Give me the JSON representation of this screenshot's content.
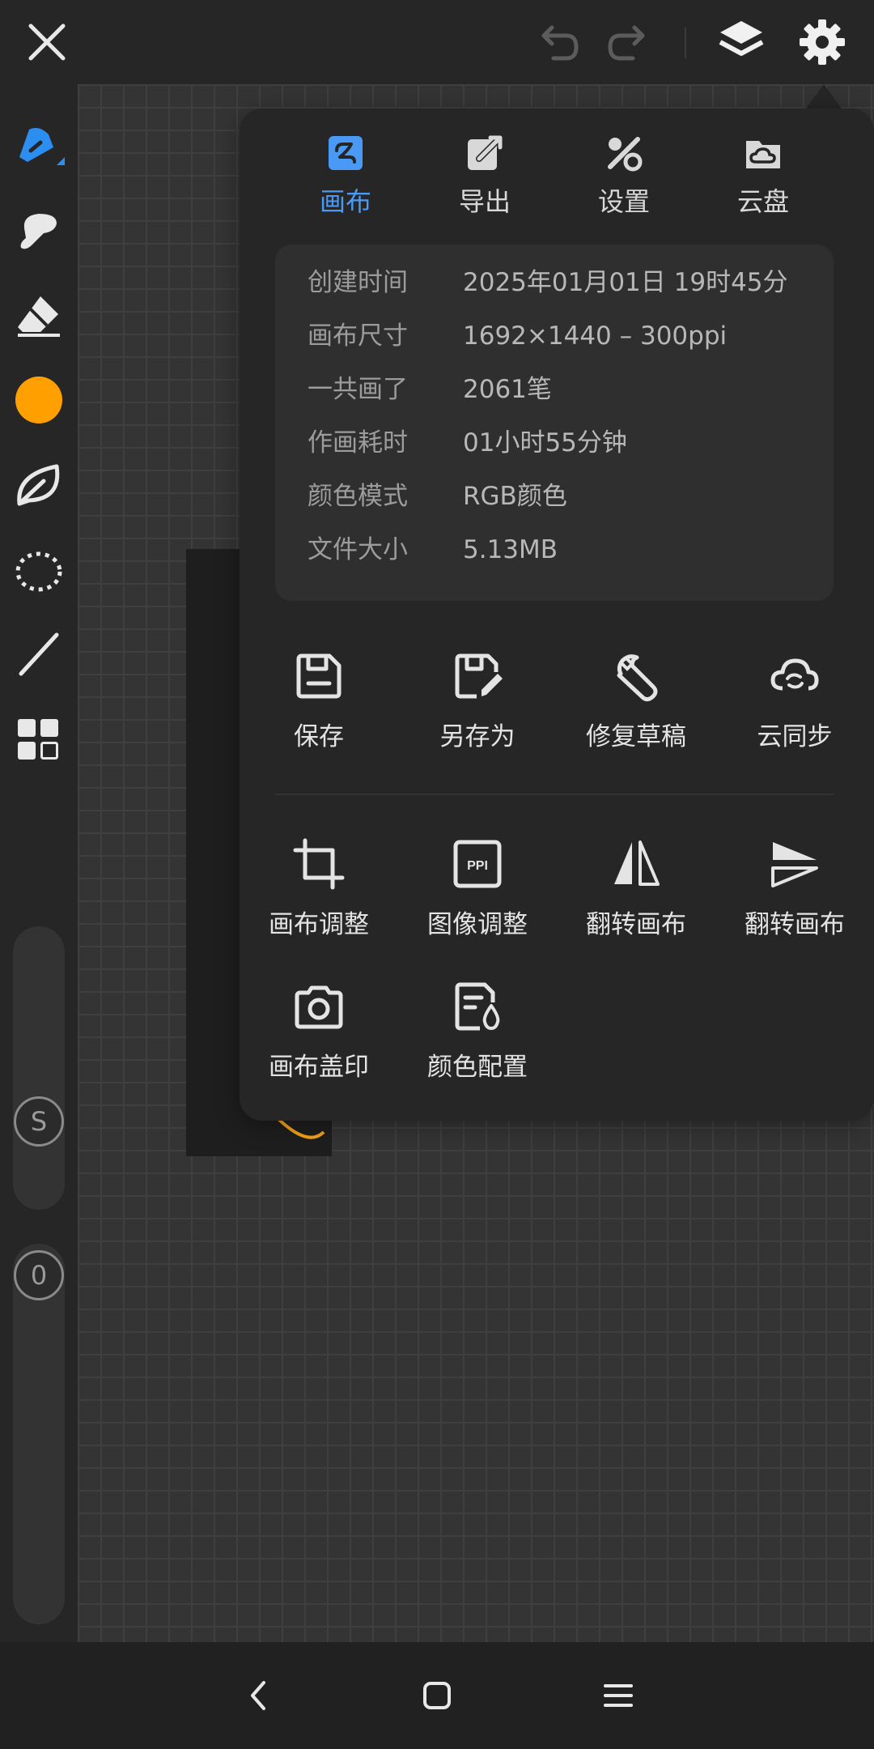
{
  "colors": {
    "accent": "#4a9af5",
    "brush_color": "#ffa000",
    "background": "#262626"
  },
  "topbar": {
    "icons": [
      "close-icon",
      "undo-icon",
      "redo-icon",
      "layers-icon",
      "settings-icon"
    ]
  },
  "left_toolbar": {
    "tools": [
      "pen-icon",
      "smudge-icon",
      "eraser-icon",
      "color-swatch",
      "leaf-icon",
      "lasso-icon",
      "line-icon",
      "grid-icon"
    ],
    "size_slider_label": "S",
    "opacity_slider_label": "0"
  },
  "panel": {
    "tabs": [
      {
        "label": "画布",
        "icon": "canvas-icon",
        "active": true
      },
      {
        "label": "导出",
        "icon": "export-icon",
        "active": false
      },
      {
        "label": "设置",
        "icon": "tools-settings-icon",
        "active": false
      },
      {
        "label": "云盘",
        "icon": "cloud-drive-icon",
        "active": false
      }
    ],
    "info": [
      {
        "label": "创建时间",
        "value": "2025年01月01日 19时45分"
      },
      {
        "label": "画布尺寸",
        "value": "1692×1440 – 300ppi"
      },
      {
        "label": "一共画了",
        "value": "2061笔"
      },
      {
        "label": "作画耗时",
        "value": "01小时55分钟"
      },
      {
        "label": "颜色模式",
        "value": "RGB颜色"
      },
      {
        "label": "文件大小",
        "value": "5.13MB"
      }
    ],
    "actions_row1": [
      {
        "label": "保存",
        "icon": "save-icon"
      },
      {
        "label": "另存为",
        "icon": "save-as-icon"
      },
      {
        "label": "修复草稿",
        "icon": "wrench-icon"
      },
      {
        "label": "云同步",
        "icon": "cloud-sync-icon"
      }
    ],
    "actions_row2": [
      {
        "label": "画布调整",
        "icon": "crop-icon"
      },
      {
        "label": "图像调整",
        "icon": "ppi-icon",
        "icon_text": "PPI"
      },
      {
        "label": "翻转画布",
        "icon": "flip-horizontal-icon"
      },
      {
        "label": "翻转画布",
        "icon": "flip-vertical-icon"
      }
    ],
    "actions_row3": [
      {
        "label": "画布盖印",
        "icon": "camera-icon"
      },
      {
        "label": "颜色配置",
        "icon": "color-profile-icon"
      }
    ]
  },
  "navbar": {
    "icons": [
      "back-icon",
      "home-icon",
      "menu-icon"
    ]
  }
}
